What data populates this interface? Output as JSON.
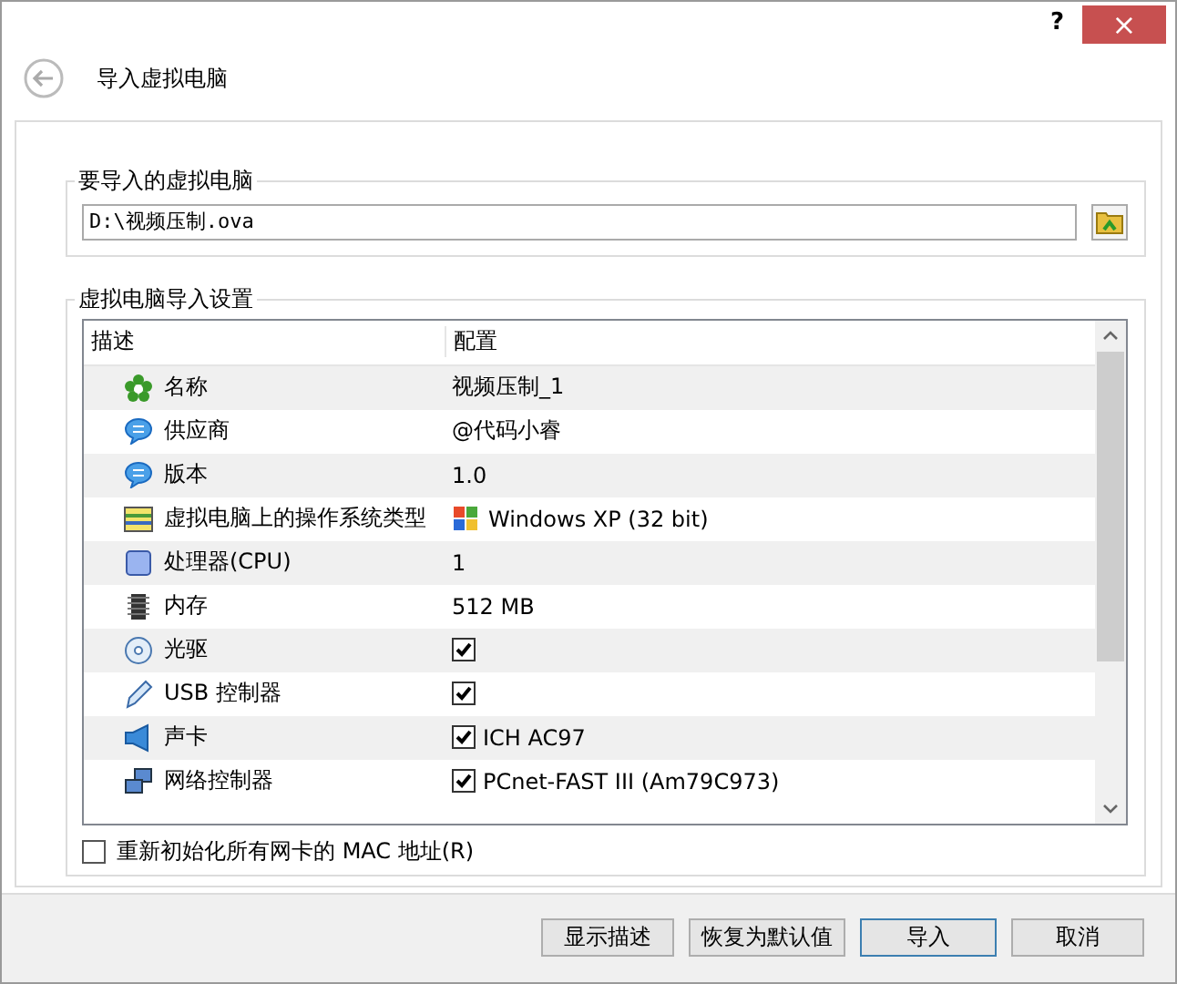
{
  "window": {
    "help": "?",
    "close": "×"
  },
  "header": {
    "title": "导入虚拟电脑"
  },
  "source_group": {
    "title": "要导入的虚拟电脑",
    "file_path": "D:\\视频压制.ova"
  },
  "settings_group": {
    "title": "虚拟电脑导入设置",
    "table": {
      "columns": [
        "描述",
        "配置"
      ],
      "rows": [
        {
          "kind": "text",
          "label": "名称",
          "value": "视频压制_1"
        },
        {
          "kind": "text",
          "label": "供应商",
          "value": "@代码小睿"
        },
        {
          "kind": "text",
          "label": "版本",
          "value": "1.0"
        },
        {
          "kind": "os",
          "label": "虚拟电脑上的操作系统类型",
          "value": "Windows XP (32 bit)"
        },
        {
          "kind": "text",
          "label": "处理器(CPU)",
          "value": "1"
        },
        {
          "kind": "text",
          "label": "内存",
          "value": "512 MB"
        },
        {
          "kind": "check",
          "label": "光驱",
          "checked": true
        },
        {
          "kind": "check",
          "label": "USB 控制器",
          "checked": true
        },
        {
          "kind": "check",
          "label": "声卡",
          "checked": true,
          "value": "ICH AC97"
        },
        {
          "kind": "check",
          "label": "网络控制器",
          "checked": true,
          "value": "PCnet-FAST III (Am79C973)"
        }
      ]
    },
    "reinit_mac": {
      "label": "重新初始化所有网卡的 MAC 地址(R)",
      "checked": false
    }
  },
  "buttons": [
    "显示描述",
    "恢复为默认值",
    "导入",
    "取消"
  ]
}
